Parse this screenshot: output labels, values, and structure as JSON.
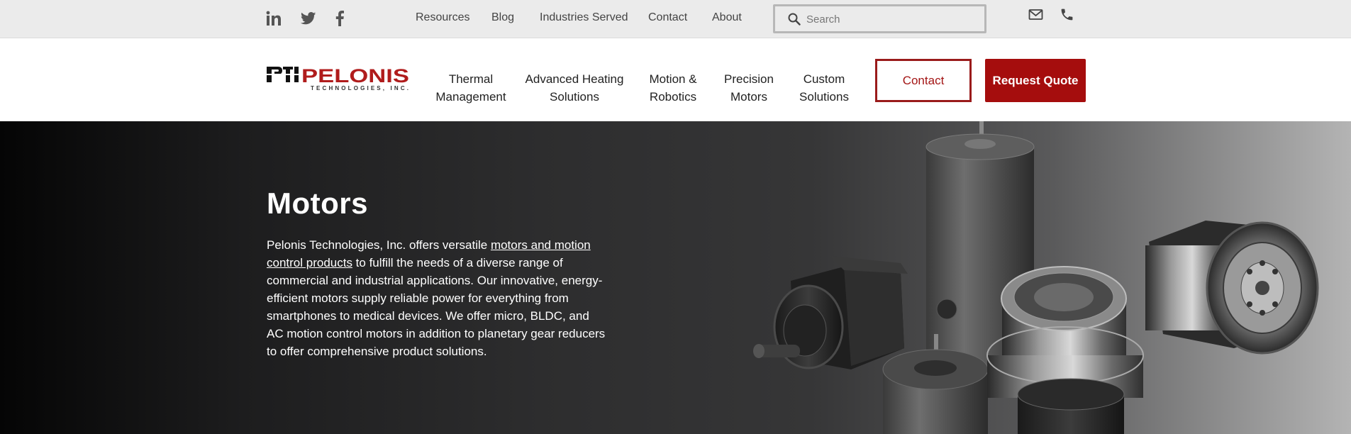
{
  "topbar": {
    "social": [
      {
        "name": "linkedin-icon"
      },
      {
        "name": "twitter-icon"
      },
      {
        "name": "facebook-icon"
      }
    ],
    "links": [
      "Resources",
      "Blog",
      "Industries Served",
      "Contact",
      "About"
    ],
    "search": {
      "placeholder": "Search",
      "value": ""
    },
    "icons": [
      "mail-icon",
      "phone-icon"
    ]
  },
  "nav": {
    "logo_text": "PTI PELONIS TECHNOLOGIES, INC.",
    "items": [
      {
        "line1": "Thermal",
        "line2": "Management"
      },
      {
        "line1": "Advanced Heating",
        "line2": "Solutions"
      },
      {
        "line1": "Motion &",
        "line2": "Robotics"
      },
      {
        "line1": "Precision",
        "line2": "Motors"
      },
      {
        "line1": "Custom",
        "line2": "Solutions"
      }
    ],
    "contact_label": "Contact",
    "quote_label": "Request Quote"
  },
  "hero": {
    "title": "Motors",
    "text_before": "Pelonis Technologies, Inc. offers versatile ",
    "link_text": "motors and motion control products",
    "text_after": " to fulfill the needs of a diverse range of commercial and industrial applications. Our innovative, energy-efficient motors supply reliable power for everything from smartphones to medical devices. We offer micro, BLDC, and AC motion control motors in addition to planetary gear reducers to offer comprehensive product solutions."
  },
  "colors": {
    "brand_red": "#a50d0d",
    "topbar_bg": "#ebebeb",
    "hero_dark": "#1d1d1e"
  }
}
